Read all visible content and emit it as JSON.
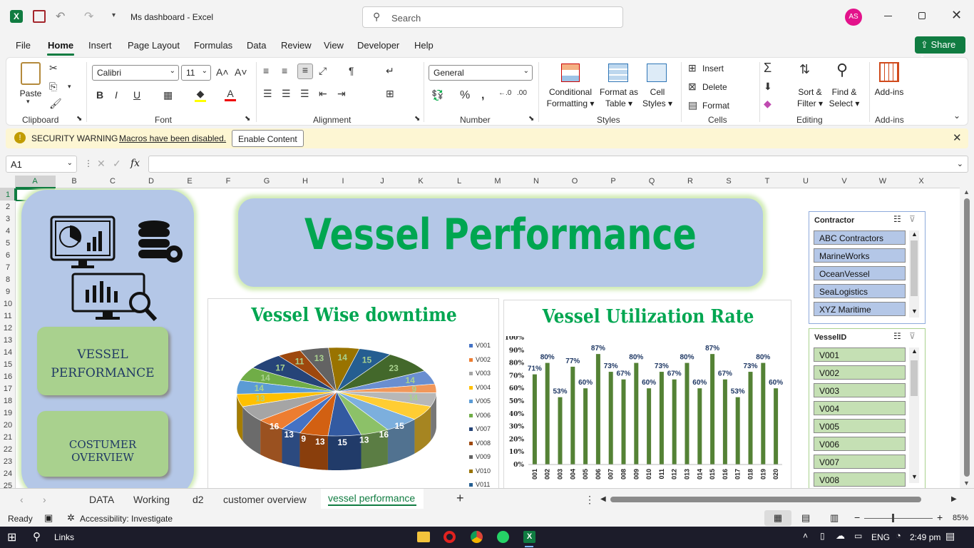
{
  "window": {
    "title": "Ms dashboard  -  Excel",
    "search_placeholder": "Search",
    "user_initials": "AS"
  },
  "menu": [
    "File",
    "Home",
    "Insert",
    "Page Layout",
    "Formulas",
    "Data",
    "Review",
    "View",
    "Developer",
    "Help"
  ],
  "share_label": "Share",
  "ribbon": {
    "clipboard": {
      "paste": "Paste",
      "group": "Clipboard"
    },
    "font": {
      "name": "Calibri",
      "size": "11",
      "group": "Font"
    },
    "alignment": {
      "group": "Alignment"
    },
    "number": {
      "format": "General",
      "group": "Number"
    },
    "styles": {
      "conditional": "Conditional",
      "formatting": "Formatting",
      "format_as": "Format as",
      "table": "Table",
      "cell": "Cell",
      "cell_styles": "Styles",
      "group": "Styles"
    },
    "cells": {
      "insert": "Insert",
      "delete": "Delete",
      "format": "Format",
      "group": "Cells"
    },
    "editing": {
      "sort": "Sort &",
      "filter": "Filter",
      "find": "Find &",
      "select": "Select",
      "group": "Editing"
    },
    "addins": {
      "label": "Add-ins",
      "group": "Add-ins"
    }
  },
  "security": {
    "title": "SECURITY WARNING",
    "message": "Macros have been disabled.",
    "button": "Enable Content"
  },
  "formula_bar": {
    "name_box": "A1",
    "fx": "fx",
    "formula": ""
  },
  "columns": [
    "A",
    "B",
    "C",
    "D",
    "E",
    "F",
    "G",
    "H",
    "I",
    "J",
    "K",
    "L",
    "M",
    "N",
    "O",
    "P",
    "Q",
    "R",
    "S",
    "T",
    "U",
    "V",
    "W",
    "X"
  ],
  "rows": [
    "1",
    "2",
    "3",
    "4",
    "5",
    "6",
    "7",
    "8",
    "9",
    "10",
    "11",
    "12",
    "13",
    "14",
    "15",
    "16",
    "17",
    "18",
    "19",
    "20",
    "21",
    "22",
    "23",
    "24",
    "25"
  ],
  "dashboard": {
    "title": "Vessel Performance",
    "nav": [
      "VESSEL PERFORMANCE",
      "COSTUMER OVERVIEW"
    ]
  },
  "chart_data": [
    {
      "type": "pie",
      "title": "Vessel Wise downtime",
      "legend": [
        "V001",
        "V002",
        "V003",
        "V004",
        "V005",
        "V006",
        "V007",
        "V008",
        "V009",
        "V010",
        "V011"
      ],
      "legend_placement": "right",
      "values": [
        9,
        13,
        16,
        13,
        14,
        14,
        17,
        11,
        13,
        14,
        15,
        23,
        14,
        9,
        14,
        15,
        16,
        13,
        15,
        13
      ]
    },
    {
      "type": "bar",
      "title": "Vessel Utilization Rate",
      "categories": [
        "V001",
        "V002",
        "V003",
        "V004",
        "V005",
        "V006",
        "V007",
        "V008",
        "V009",
        "V010",
        "V011",
        "V012",
        "V013",
        "V014",
        "V015",
        "V016",
        "V017",
        "V018",
        "V019",
        "V020"
      ],
      "tick_labels": [
        "001",
        "002",
        "003",
        "004",
        "005",
        "006",
        "007",
        "008",
        "009",
        "010",
        "011",
        "012",
        "013",
        "014",
        "015",
        "016",
        "017",
        "018",
        "019",
        "020"
      ],
      "values": [
        71,
        80,
        53,
        77,
        60,
        87,
        73,
        67,
        80,
        60,
        73,
        67,
        80,
        60,
        87,
        67,
        53,
        73,
        80,
        60
      ],
      "data_labels": [
        "71%",
        "80%",
        "53%",
        "77%",
        "60%",
        "87%",
        "73%",
        "67%",
        "80%",
        "60%",
        "73%",
        "67%",
        "80%",
        "60%",
        "87%",
        "67%",
        "53%",
        "73%",
        "80%",
        "60%"
      ],
      "yticks": [
        "0%",
        "10%",
        "20%",
        "30%",
        "40%",
        "50%",
        "60%",
        "70%",
        "80%",
        "90%",
        "100%"
      ],
      "ylim": [
        0,
        100
      ]
    }
  ],
  "slicers": {
    "contractor": {
      "title": "Contractor",
      "items": [
        "ABC Contractors",
        "MarineWorks",
        "OceanVessel",
        "SeaLogistics",
        "XYZ Maritime"
      ]
    },
    "vessel": {
      "title": "VesselID",
      "items": [
        "V001",
        "V002",
        "V003",
        "V004",
        "V005",
        "V006",
        "V007",
        "V008"
      ]
    }
  },
  "tabs": [
    "DATA",
    "Working",
    "d2",
    "customer overview",
    "vessel performance"
  ],
  "status": {
    "ready": "Ready",
    "accessibility": "Accessibility: Investigate",
    "zoom": "85%"
  },
  "taskbar": {
    "search": "Links",
    "lang": "ENG",
    "time": "2:49 pm"
  },
  "colors": {
    "green_title": "#00a651",
    "bar": "#548235",
    "nav_green": "#a9d18e",
    "panel_blue": "#b4c7e7"
  }
}
